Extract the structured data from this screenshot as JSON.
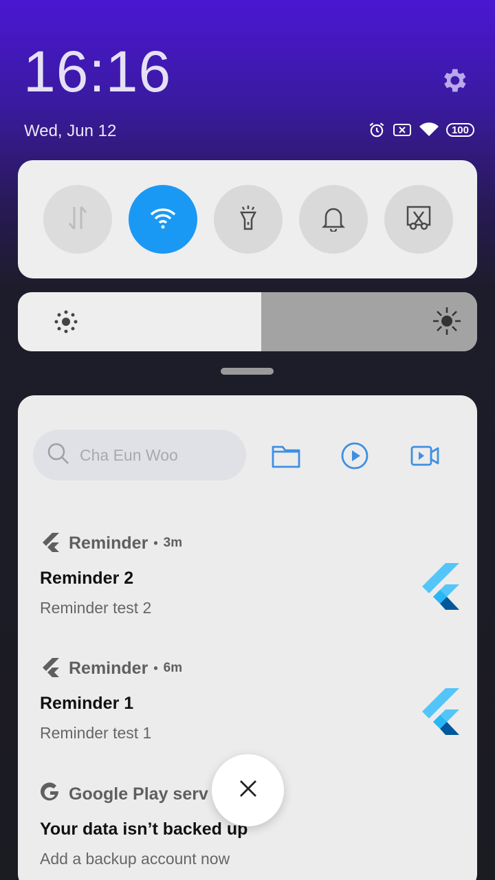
{
  "status": {
    "time": "16:16",
    "date": "Wed, Jun 12",
    "battery": "100"
  },
  "quick_settings": [
    {
      "name": "mobile-data",
      "icon": "data-transfer-icon",
      "state": "disabled"
    },
    {
      "name": "wifi",
      "icon": "wifi-icon",
      "state": "on"
    },
    {
      "name": "flashlight",
      "icon": "flashlight-icon",
      "state": "off"
    },
    {
      "name": "sound",
      "icon": "bell-icon",
      "state": "off"
    },
    {
      "name": "screenshot",
      "icon": "scissors-icon",
      "state": "off"
    }
  ],
  "brightness": {
    "level": 0.53
  },
  "search": {
    "placeholder": "Cha Eun Woo"
  },
  "shortcuts": [
    "folder-icon",
    "play-icon",
    "video-icon"
  ],
  "notifications": [
    {
      "app": "Reminder",
      "time": "3m",
      "title": "Reminder 2",
      "text": "Reminder test 2"
    },
    {
      "app": "Reminder",
      "time": "6m",
      "title": "Reminder 1",
      "text": "Reminder test 1"
    },
    {
      "app": "Google Play serv",
      "time": "",
      "title": "Your data isn’t backed up",
      "text": "Add a backup account now"
    }
  ],
  "colors": {
    "accent": "#1a99f4",
    "shortcut_blue": "#3d8fe3",
    "flutter_light": "#54c5f8",
    "flutter_dark": "#01579b"
  }
}
